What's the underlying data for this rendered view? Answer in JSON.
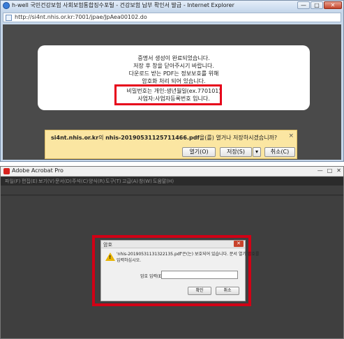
{
  "ie": {
    "title": "h-well 국민건강보험 사회보험통합징수포털 - 건강보험 납부 확인서 발급 - Internet Explorer",
    "url": "http://si4nt.nhis.or.kr:7001/jpae/JpAea00102.do",
    "controls": {
      "minimize": "—",
      "maximize": "□",
      "close": "✕"
    },
    "message_lines": [
      "증명서 생성이 완료되었습니다.",
      "저장 후 창을 닫아주시기 바랍니다.",
      "다운로드 받는 PDF는 정보보호를 위해",
      "암호화 처리 되어 있습니다.",
      "비밀번호는 개인:생년월일(ex.770101)",
      "사업자:사업자등록번호 입니다."
    ],
    "download_bar": {
      "host": "si4nt.nhis.or.kr",
      "connector": "의 ",
      "filename": "nhis-20190531125711466.pdf",
      "suffix": "을(를) 열거나 저장하시겠습니까?",
      "close": "×",
      "open_label": "열기(O)",
      "save_label": "저장(S)",
      "save_arrow": "▾",
      "cancel_label": "취소(C)"
    }
  },
  "acrobat": {
    "title": "Adobe Acrobat Pro",
    "controls": {
      "minimize": "—",
      "maximize": "□",
      "close": "✕"
    },
    "menu": [
      "파일(F)",
      "편집(E)",
      "보기(V)",
      "문서(D)",
      "주석(C)",
      "양식(R)",
      "도구(T)",
      "고급(A)",
      "창(W)",
      "도움말(H)"
    ],
    "dialog": {
      "title": "암호",
      "close": "✕",
      "message_line1": "'nhis-20190531131322135.pdf'은(는) 보호되어 있습니다. 문서 열기 암호를",
      "message_line2": "입력하십시오.",
      "password_label": "암호 입력(E):",
      "ok_label": "확인",
      "cancel_label": "취소"
    }
  }
}
